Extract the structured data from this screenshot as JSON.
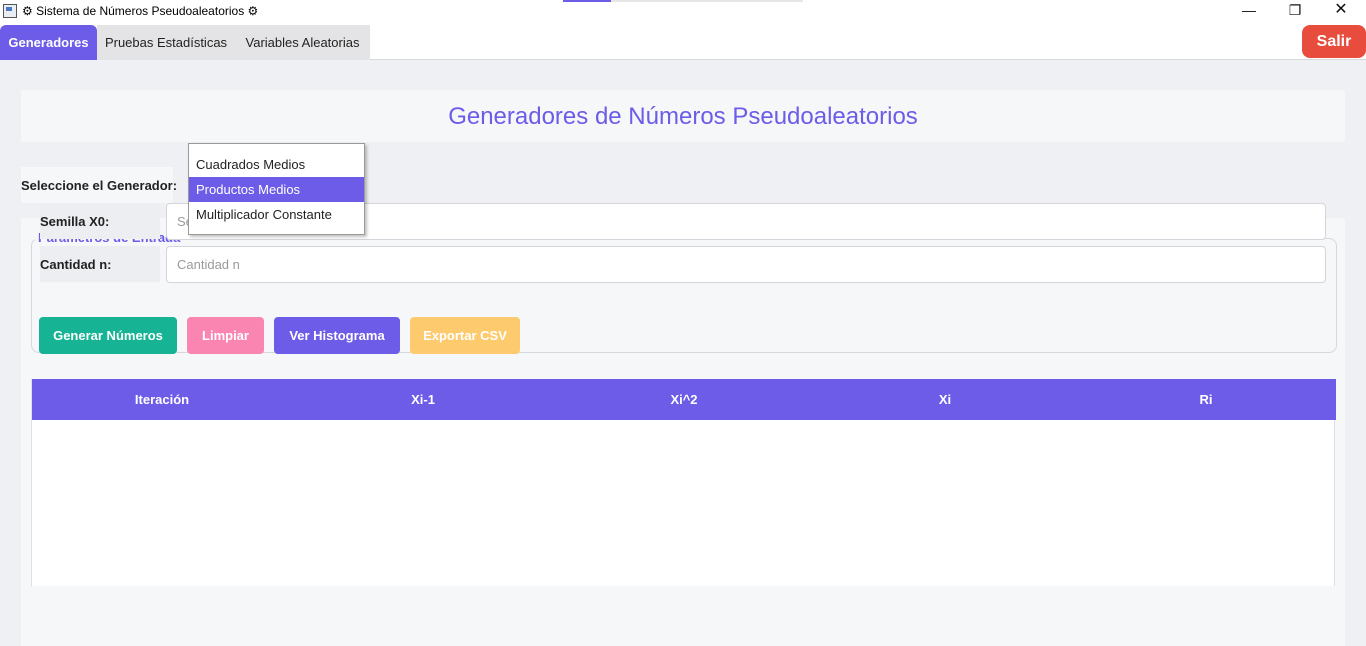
{
  "window": {
    "title": "⚙ Sistema de Números Pseudoaleatorios ⚙",
    "controls": {
      "minimize": "—",
      "maximize": "❐",
      "close": "✕"
    }
  },
  "tabs": [
    {
      "label": "Generadores",
      "active": true
    },
    {
      "label": "Pruebas Estadísticas",
      "active": false
    },
    {
      "label": "Variables Aleatorias",
      "active": false
    }
  ],
  "exit_label": "Salir",
  "page_title": "Generadores de Números Pseudoaleatorios",
  "generator": {
    "label": "Seleccione el Generador:",
    "options": [
      "Cuadrados Medios",
      "Productos Medios",
      "Multiplicador Constante"
    ],
    "highlighted": "Productos Medios"
  },
  "params": {
    "legend": "Parámetros de Entrada",
    "seed_label": "Semilla X0:",
    "seed_placeholder": "Semilla X0",
    "qty_label": "Cantidad n:",
    "qty_placeholder": "Cantidad n"
  },
  "buttons": {
    "generate": "Generar Números",
    "clear": "Limpiar",
    "histogram": "Ver Histograma",
    "export": "Exportar CSV"
  },
  "table": {
    "columns": [
      "Iteración",
      "Xi-1",
      "Xi^2",
      "Xi",
      "Ri"
    ],
    "rows": []
  },
  "colors": {
    "accent": "#6c5ce7",
    "exit": "#e74c3c",
    "generate": "#16b394",
    "clear": "#f985b0",
    "export": "#fdcb6e"
  },
  "icons": {
    "app": "window-icon",
    "minimize": "minimize-icon",
    "maximize": "restore-icon",
    "close": "close-icon"
  }
}
